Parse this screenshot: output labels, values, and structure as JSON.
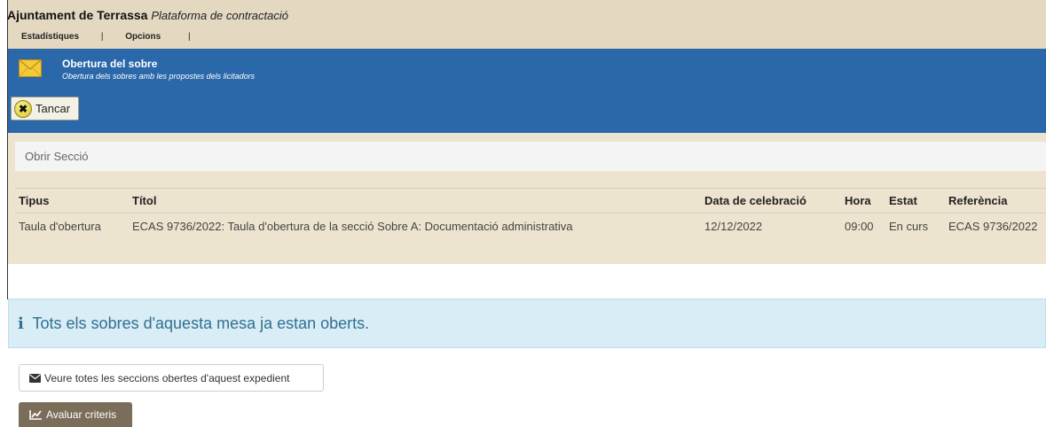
{
  "header": {
    "org_name": "Ajuntament de Terrassa",
    "platform_name": "Plataforma de contractació",
    "menu": [
      {
        "label": "Estadístiques"
      },
      {
        "label": "Opcions"
      }
    ],
    "menu_separator": "|"
  },
  "banner": {
    "icon": "envelope-icon",
    "title": "Obertura del sobre",
    "subtitle": "Obertura dels sobres amb les propostes dels licitadors",
    "close_label": "Tancar"
  },
  "section": {
    "open_section_label": "Obrir Secció"
  },
  "table": {
    "headers": [
      "Tipus",
      "Títol",
      "Data de celebració",
      "Hora",
      "Estat",
      "Referència"
    ],
    "rows": [
      [
        "Taula d'obertura",
        "ECAS 9736/2022: Taula d'obertura de la secció Sobre A: Documentació administrativa",
        "12/12/2022",
        "09:00",
        "En curs",
        "ECAS 9736/2022"
      ]
    ]
  },
  "alert": {
    "icon": "info-icon",
    "text": "Tots els sobres d'aquesta mesa ja estan oberts."
  },
  "actions": {
    "view_all_label": "Veure totes les seccions obertes d'aquest expedient",
    "evaluate_label": "Avaluar criteris"
  },
  "colors": {
    "header_bg": "#e4d8c1",
    "banner_bg": "#2a68aa",
    "panel_bg": "#ede4cf",
    "alert_bg": "#d9edf7",
    "alert_text": "#31708f",
    "eval_button_bg": "#7a6d5a"
  }
}
